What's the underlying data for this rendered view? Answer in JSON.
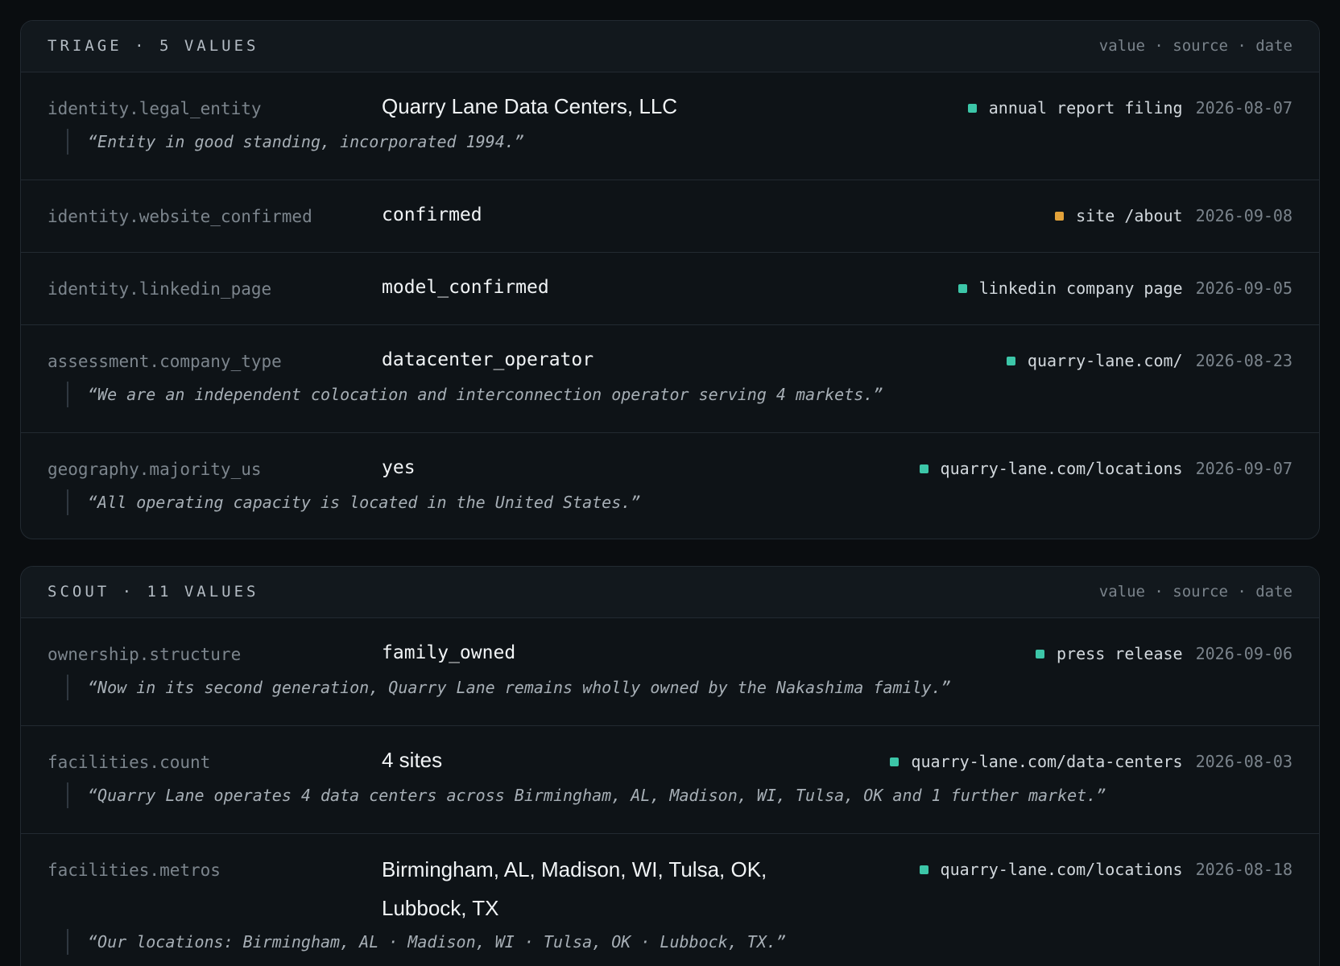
{
  "colors": {
    "verified": "#3cc6a8",
    "partial": "#e2a23a"
  },
  "triage": {
    "title": "TRIAGE · 5 VALUES",
    "legend": "value · source · date",
    "rows": [
      {
        "field": "identity.legal_entity",
        "value": "Quarry Lane Data Centers, LLC",
        "source": "annual report filing",
        "date": "2026-08-07",
        "status": "verified",
        "quote": "“Entity in good standing, incorporated 1994.”"
      },
      {
        "field": "identity.website_confirmed",
        "value": "confirmed",
        "source": "site /about",
        "date": "2026-09-08",
        "status": "partial"
      },
      {
        "field": "identity.linkedin_page",
        "value": "model_confirmed",
        "source": "linkedin company page",
        "date": "2026-09-05",
        "status": "verified"
      },
      {
        "field": "assessment.company_type",
        "value": "datacenter_operator",
        "source": "quarry-lane.com/",
        "date": "2026-08-23",
        "status": "verified",
        "quote": "“We are an independent colocation and interconnection operator serving 4 markets.”"
      },
      {
        "field": "geography.majority_us",
        "value": "yes",
        "source": "quarry-lane.com/locations",
        "date": "2026-09-07",
        "status": "verified",
        "quote": "“All operating capacity is located in the United States.”"
      }
    ]
  },
  "scout": {
    "title": "SCOUT · 11 VALUES",
    "legend": "value · source · date",
    "rows": [
      {
        "field": "ownership.structure",
        "value": "family_owned",
        "source": "press release",
        "date": "2026-09-06",
        "status": "verified",
        "quote": "“Now in its second generation, Quarry Lane remains wholly owned by the Nakashima family.”"
      },
      {
        "field": "facilities.count",
        "value": "4 sites",
        "source": "quarry-lane.com/data-centers",
        "date": "2026-08-03",
        "status": "verified",
        "quote": "“Quarry Lane operates 4 data centers across Birmingham, AL, Madison, WI, Tulsa, OK and 1 further market.”"
      },
      {
        "field": "facilities.metros",
        "value": "Birmingham, AL, Madison, WI, Tulsa, OK, Lubbock, TX",
        "source": "quarry-lane.com/locations",
        "date": "2026-08-18",
        "status": "verified",
        "quote": "“Our locations: Birmingham, AL · Madison, WI · Tulsa, OK · Lubbock, TX.”"
      }
    ]
  }
}
